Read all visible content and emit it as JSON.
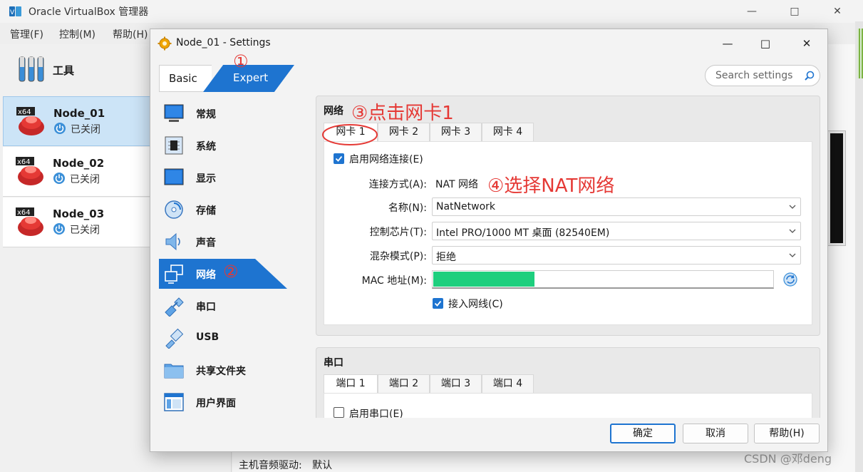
{
  "main_window": {
    "title": "Oracle VirtualBox 管理器",
    "menu": [
      "管理(F)",
      "控制(M)",
      "帮助(H)"
    ],
    "tools_label": "工具",
    "vms": [
      {
        "name": "Node_01",
        "state": "已关闭",
        "os_badge": "x64",
        "selected": true
      },
      {
        "name": "Node_02",
        "state": "已关闭",
        "os_badge": "x64",
        "selected": false
      },
      {
        "name": "Node_03",
        "state": "已关闭",
        "os_badge": "x64",
        "selected": false
      }
    ],
    "bottom_label": "主机音频驱动:",
    "bottom_value": "默认"
  },
  "dialog": {
    "title": "Node_01 - Settings",
    "mode_tabs": {
      "basic": "Basic",
      "expert": "Expert",
      "active": "expert"
    },
    "search": {
      "placeholder": "Search settings"
    },
    "nav": [
      {
        "id": "general",
        "label": "常规",
        "icon": "monitor-icon"
      },
      {
        "id": "system",
        "label": "系统",
        "icon": "chip-icon"
      },
      {
        "id": "display",
        "label": "显示",
        "icon": "display-icon"
      },
      {
        "id": "storage",
        "label": "存储",
        "icon": "disc-icon"
      },
      {
        "id": "audio",
        "label": "声音",
        "icon": "speaker-icon"
      },
      {
        "id": "network",
        "label": "网络",
        "icon": "network-icon",
        "active": true
      },
      {
        "id": "serial",
        "label": "串口",
        "icon": "serial-cable-icon"
      },
      {
        "id": "usb",
        "label": "USB",
        "icon": "usb-icon"
      },
      {
        "id": "shared",
        "label": "共享文件夹",
        "icon": "folder-icon"
      },
      {
        "id": "ui",
        "label": "用户界面",
        "icon": "window-layout-icon"
      }
    ],
    "network": {
      "title": "网络",
      "tabs": [
        "网卡 1",
        "网卡 2",
        "网卡 3",
        "网卡 4"
      ],
      "active_tab": 0,
      "enable_label": "启用网络连接(E)",
      "enable_checked": true,
      "attached_label": "连接方式(A):",
      "attached_value": "NAT 网络",
      "name_label": "名称(N):",
      "name_value": "NatNetwork",
      "adapter_label": "控制芯片(T):",
      "adapter_value": "Intel PRO/1000 MT 桌面 (82540EM)",
      "promisc_label": "混杂模式(P):",
      "promisc_value": "拒绝",
      "mac_label": "MAC 地址(M):",
      "cable_label": "接入网线(C)",
      "cable_checked": true
    },
    "serial": {
      "title": "串口",
      "tabs": [
        "端口 1",
        "端口 2",
        "端口 3",
        "端口 4"
      ],
      "active_tab": 0,
      "enable_label": "启用串口(E)",
      "enable_checked": false
    },
    "buttons": {
      "ok": "确定",
      "cancel": "取消",
      "help": "帮助(H)"
    }
  },
  "annotations": {
    "a1": "①",
    "a2": "②",
    "a3": "③点击网卡1",
    "a4": "④选择NAT网络"
  },
  "watermark": "CSDN @邓deng",
  "colors": {
    "accent": "#1e74d0",
    "annotation": "#e53935",
    "mac_redaction": "#1ecf7e"
  }
}
